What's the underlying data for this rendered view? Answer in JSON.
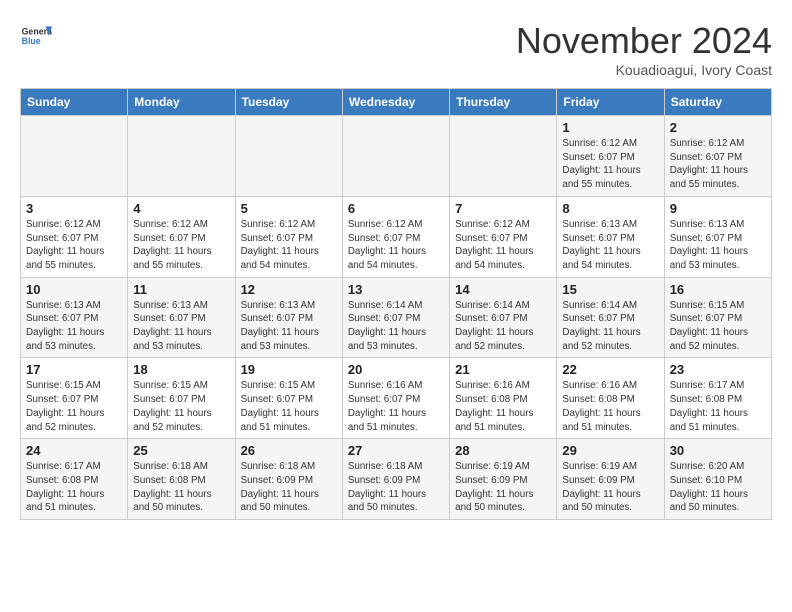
{
  "header": {
    "logo_line1": "General",
    "logo_line2": "Blue",
    "month_year": "November 2024",
    "location": "Kouadioagui, Ivory Coast"
  },
  "days_of_week": [
    "Sunday",
    "Monday",
    "Tuesday",
    "Wednesday",
    "Thursday",
    "Friday",
    "Saturday"
  ],
  "weeks": [
    [
      {
        "day": "",
        "info": ""
      },
      {
        "day": "",
        "info": ""
      },
      {
        "day": "",
        "info": ""
      },
      {
        "day": "",
        "info": ""
      },
      {
        "day": "",
        "info": ""
      },
      {
        "day": "1",
        "info": "Sunrise: 6:12 AM\nSunset: 6:07 PM\nDaylight: 11 hours and 55 minutes."
      },
      {
        "day": "2",
        "info": "Sunrise: 6:12 AM\nSunset: 6:07 PM\nDaylight: 11 hours and 55 minutes."
      }
    ],
    [
      {
        "day": "3",
        "info": "Sunrise: 6:12 AM\nSunset: 6:07 PM\nDaylight: 11 hours and 55 minutes."
      },
      {
        "day": "4",
        "info": "Sunrise: 6:12 AM\nSunset: 6:07 PM\nDaylight: 11 hours and 55 minutes."
      },
      {
        "day": "5",
        "info": "Sunrise: 6:12 AM\nSunset: 6:07 PM\nDaylight: 11 hours and 54 minutes."
      },
      {
        "day": "6",
        "info": "Sunrise: 6:12 AM\nSunset: 6:07 PM\nDaylight: 11 hours and 54 minutes."
      },
      {
        "day": "7",
        "info": "Sunrise: 6:12 AM\nSunset: 6:07 PM\nDaylight: 11 hours and 54 minutes."
      },
      {
        "day": "8",
        "info": "Sunrise: 6:13 AM\nSunset: 6:07 PM\nDaylight: 11 hours and 54 minutes."
      },
      {
        "day": "9",
        "info": "Sunrise: 6:13 AM\nSunset: 6:07 PM\nDaylight: 11 hours and 53 minutes."
      }
    ],
    [
      {
        "day": "10",
        "info": "Sunrise: 6:13 AM\nSunset: 6:07 PM\nDaylight: 11 hours and 53 minutes."
      },
      {
        "day": "11",
        "info": "Sunrise: 6:13 AM\nSunset: 6:07 PM\nDaylight: 11 hours and 53 minutes."
      },
      {
        "day": "12",
        "info": "Sunrise: 6:13 AM\nSunset: 6:07 PM\nDaylight: 11 hours and 53 minutes."
      },
      {
        "day": "13",
        "info": "Sunrise: 6:14 AM\nSunset: 6:07 PM\nDaylight: 11 hours and 53 minutes."
      },
      {
        "day": "14",
        "info": "Sunrise: 6:14 AM\nSunset: 6:07 PM\nDaylight: 11 hours and 52 minutes."
      },
      {
        "day": "15",
        "info": "Sunrise: 6:14 AM\nSunset: 6:07 PM\nDaylight: 11 hours and 52 minutes."
      },
      {
        "day": "16",
        "info": "Sunrise: 6:15 AM\nSunset: 6:07 PM\nDaylight: 11 hours and 52 minutes."
      }
    ],
    [
      {
        "day": "17",
        "info": "Sunrise: 6:15 AM\nSunset: 6:07 PM\nDaylight: 11 hours and 52 minutes."
      },
      {
        "day": "18",
        "info": "Sunrise: 6:15 AM\nSunset: 6:07 PM\nDaylight: 11 hours and 52 minutes."
      },
      {
        "day": "19",
        "info": "Sunrise: 6:15 AM\nSunset: 6:07 PM\nDaylight: 11 hours and 51 minutes."
      },
      {
        "day": "20",
        "info": "Sunrise: 6:16 AM\nSunset: 6:07 PM\nDaylight: 11 hours and 51 minutes."
      },
      {
        "day": "21",
        "info": "Sunrise: 6:16 AM\nSunset: 6:08 PM\nDaylight: 11 hours and 51 minutes."
      },
      {
        "day": "22",
        "info": "Sunrise: 6:16 AM\nSunset: 6:08 PM\nDaylight: 11 hours and 51 minutes."
      },
      {
        "day": "23",
        "info": "Sunrise: 6:17 AM\nSunset: 6:08 PM\nDaylight: 11 hours and 51 minutes."
      }
    ],
    [
      {
        "day": "24",
        "info": "Sunrise: 6:17 AM\nSunset: 6:08 PM\nDaylight: 11 hours and 51 minutes."
      },
      {
        "day": "25",
        "info": "Sunrise: 6:18 AM\nSunset: 6:08 PM\nDaylight: 11 hours and 50 minutes."
      },
      {
        "day": "26",
        "info": "Sunrise: 6:18 AM\nSunset: 6:09 PM\nDaylight: 11 hours and 50 minutes."
      },
      {
        "day": "27",
        "info": "Sunrise: 6:18 AM\nSunset: 6:09 PM\nDaylight: 11 hours and 50 minutes."
      },
      {
        "day": "28",
        "info": "Sunrise: 6:19 AM\nSunset: 6:09 PM\nDaylight: 11 hours and 50 minutes."
      },
      {
        "day": "29",
        "info": "Sunrise: 6:19 AM\nSunset: 6:09 PM\nDaylight: 11 hours and 50 minutes."
      },
      {
        "day": "30",
        "info": "Sunrise: 6:20 AM\nSunset: 6:10 PM\nDaylight: 11 hours and 50 minutes."
      }
    ]
  ]
}
